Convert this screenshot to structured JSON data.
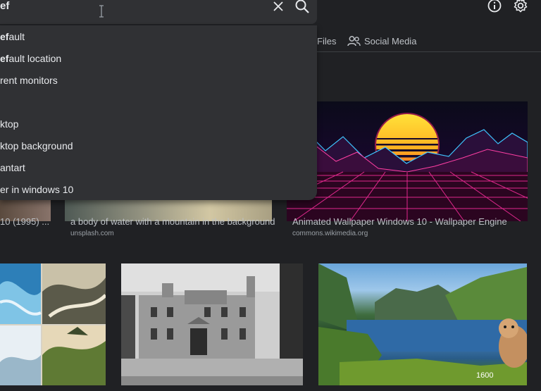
{
  "search": {
    "query": "ef"
  },
  "nav": {
    "files_label": "Files",
    "social_label": "Social Media"
  },
  "suggestions": [
    {
      "bold": "ef",
      "rest": "ault"
    },
    {
      "bold": "ef",
      "rest": "ault location"
    },
    {
      "bold": "",
      "rest": "rent monitors"
    },
    {
      "bold": "",
      "rest": "ktop"
    },
    {
      "bold": "",
      "rest": "ktop background"
    },
    {
      "bold": "",
      "rest": "antart"
    },
    {
      "bold": "",
      "rest": "er in windows 10"
    }
  ],
  "results": {
    "row1": [
      {
        "caption": "10 (1995) ..."
      },
      {
        "caption": "a body of water with a mountain in the background",
        "source": "unsplash.com"
      },
      {
        "caption": "Animated Wallpaper Windows 10 - Wallpaper Engine",
        "source": "commons.wikimedia.org"
      }
    ],
    "fjord_badge": "1600"
  },
  "colors": {
    "background": "#202124",
    "surface": "#303134",
    "text": "#e8eaed",
    "muted": "#bdc1c6"
  }
}
